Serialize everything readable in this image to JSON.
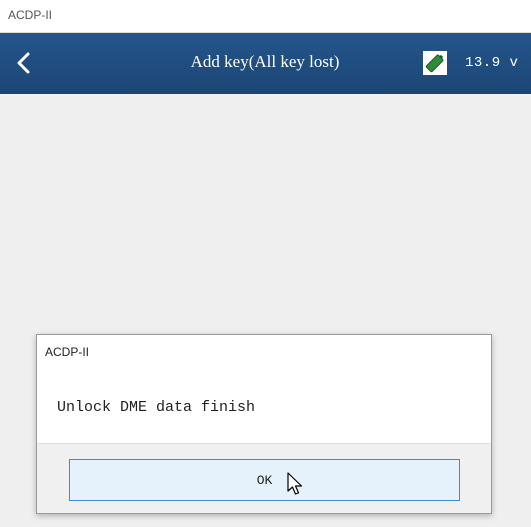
{
  "window": {
    "title": "ACDP-II"
  },
  "header": {
    "title": "Add key(All key lost)",
    "back_icon": "chevron-left-icon",
    "battery_icon": "battery-icon",
    "voltage": "13.9 v",
    "bg_color": "#1f4c7e",
    "battery_color": "#2e8b3a"
  },
  "dialog": {
    "title": "ACDP-II",
    "message": "Unlock DME data finish",
    "ok_label": "OK"
  }
}
